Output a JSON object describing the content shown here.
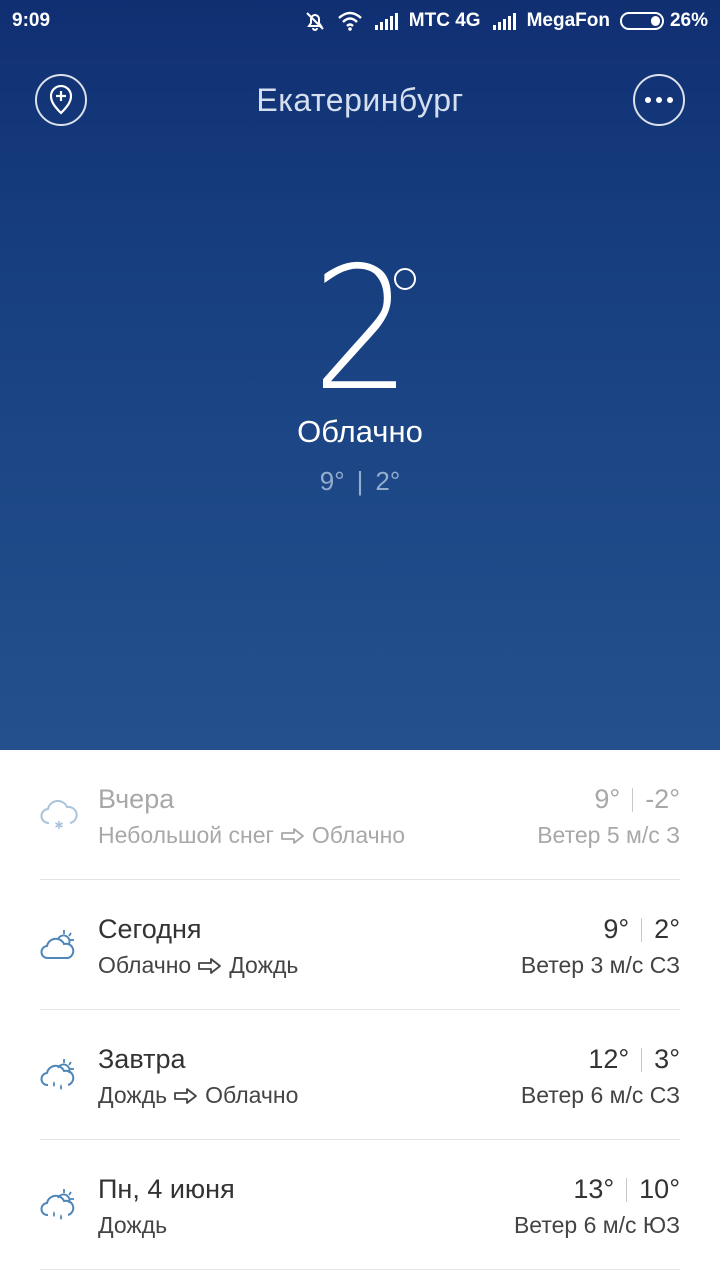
{
  "status_bar": {
    "time": "9:09",
    "carrier1": "МТС 4G",
    "carrier2": "MegaFon",
    "battery": "26%",
    "battery_level": 0.26
  },
  "header": {
    "city": "Екатеринбург",
    "add_icon": "add-location-icon",
    "more_icon": "more-dots-icon"
  },
  "current": {
    "temp": "2",
    "condition": "Облачно",
    "high": "9°",
    "low": "2°",
    "separator": "|"
  },
  "forecast": [
    {
      "day": "Вчера",
      "from": "Небольшой снег",
      "to": "Облачно",
      "high": "9°",
      "low": "-2°",
      "wind": "Ветер 5 м/с З",
      "icon": "snow-cloud-icon"
    },
    {
      "day": "Сегодня",
      "from": "Облачно",
      "to": "Дождь",
      "high": "9°",
      "low": "2°",
      "wind": "Ветер 3 м/с СЗ",
      "icon": "partly-cloudy-icon"
    },
    {
      "day": "Завтра",
      "from": "Дождь",
      "to": "Облачно",
      "high": "12°",
      "low": "3°",
      "wind": "Ветер 6 м/с СЗ",
      "icon": "rain-cloud-icon"
    },
    {
      "day": "Пн, 4 июня",
      "from": "Дождь",
      "to": "",
      "high": "13°",
      "low": "10°",
      "wind": "Ветер 6 м/с ЮЗ",
      "icon": "rain-cloud-icon"
    }
  ],
  "colors": {
    "hero_top": "#102f72",
    "hero_bottom": "#24518e",
    "icon_blue": "#4f86b8",
    "icon_faded": "#a9c3dc"
  }
}
